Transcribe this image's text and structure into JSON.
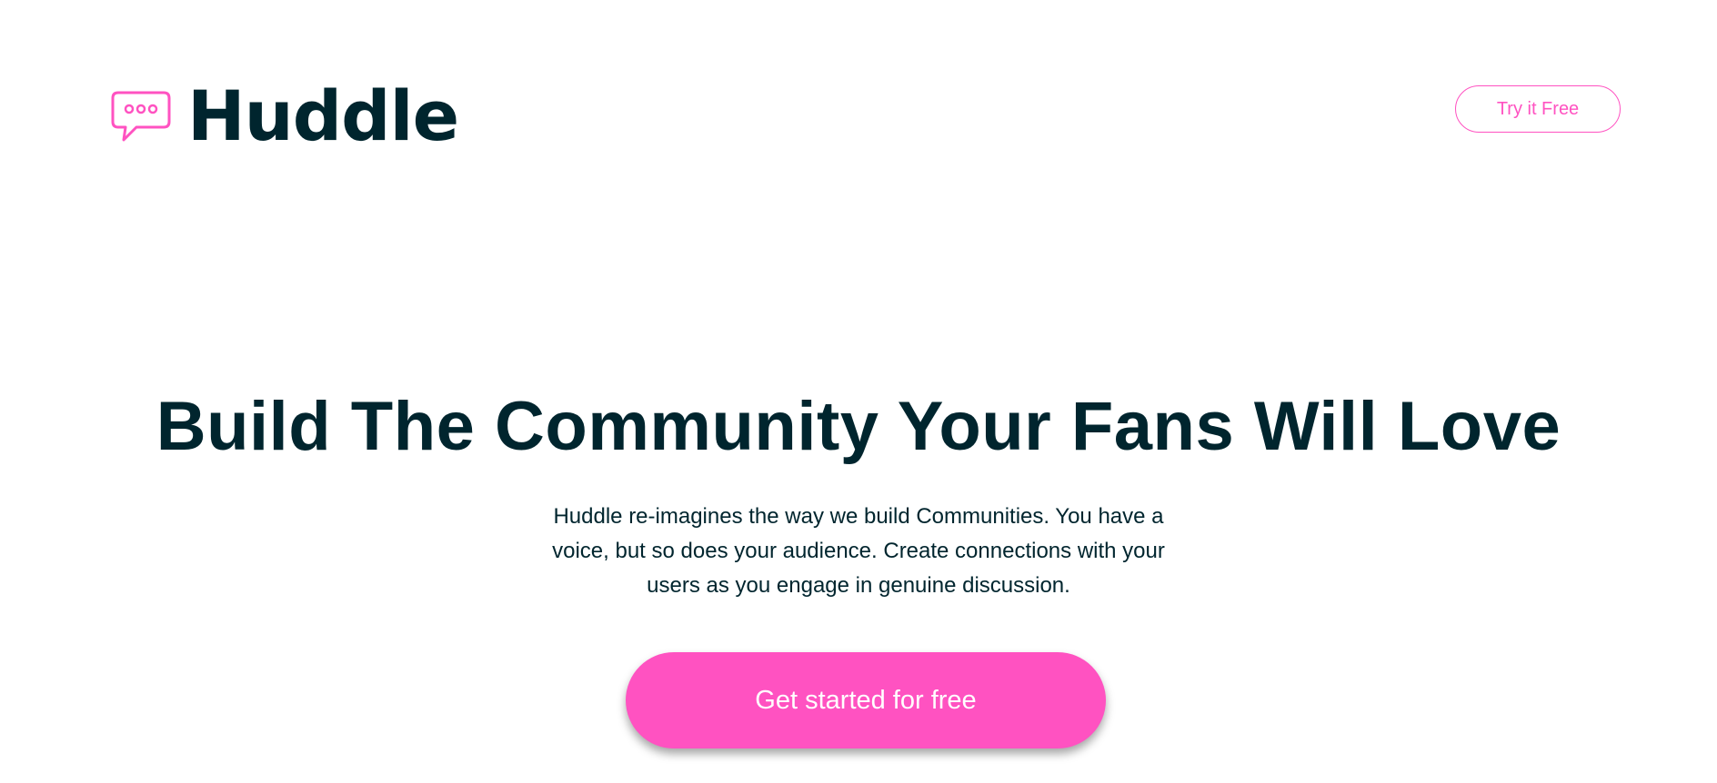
{
  "header": {
    "logo": {
      "icon": "chat-bubble-icon",
      "text": "Huddle"
    },
    "try_button_label": "Try it Free"
  },
  "hero": {
    "title": "Build The Community Your Fans Will Love",
    "description": "Huddle re-imagines the way we build Communities. You have a voice, but so does your audience. Create connections with your users as you engage in genuine discussion.",
    "cta_label": "Get started for free"
  },
  "colors": {
    "accent": "#ff52c1",
    "text_dark": "#00252e",
    "background": "#ffffff"
  }
}
